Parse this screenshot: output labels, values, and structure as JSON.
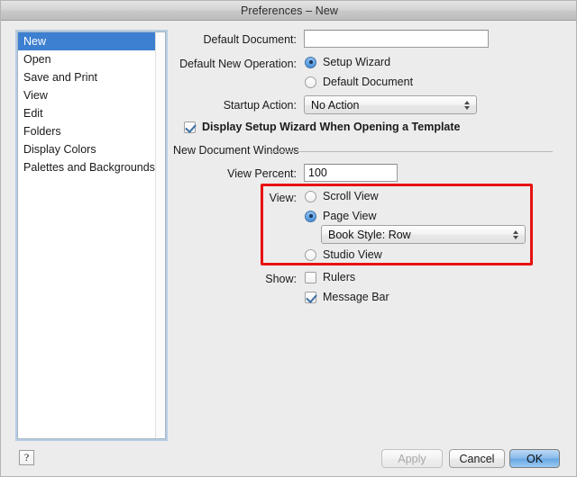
{
  "window": {
    "title": "Preferences – New"
  },
  "sidebar": {
    "items": [
      {
        "label": "New",
        "selected": true
      },
      {
        "label": "Open",
        "selected": false
      },
      {
        "label": "Save and Print",
        "selected": false
      },
      {
        "label": "View",
        "selected": false
      },
      {
        "label": "Edit",
        "selected": false
      },
      {
        "label": "Folders",
        "selected": false
      },
      {
        "label": "Display Colors",
        "selected": false
      },
      {
        "label": "Palettes and Backgrounds",
        "selected": false
      }
    ]
  },
  "form": {
    "default_document_label": "Default Document:",
    "default_document_value": "",
    "default_new_operation_label": "Default New Operation:",
    "setup_wizard_label": "Setup Wizard",
    "default_document_radio_label": "Default Document",
    "startup_action_label": "Startup Action:",
    "startup_action_value": "No Action",
    "display_setup_wizard_label": "Display Setup Wizard When Opening a Template"
  },
  "group": {
    "title": "New Document Windows",
    "view_percent_label": "View Percent:",
    "view_percent_value": "100",
    "view_label": "View:",
    "scroll_view_label": "Scroll View",
    "page_view_label": "Page View",
    "book_style_value": "Book Style: Row",
    "studio_view_label": "Studio View",
    "show_label": "Show:",
    "rulers_label": "Rulers",
    "message_bar_label": "Message Bar"
  },
  "footer": {
    "help_glyph": "?",
    "apply_label": "Apply",
    "cancel_label": "Cancel",
    "ok_label": "OK"
  },
  "colors": {
    "selection_blue": "#3d7fd0",
    "annotation_red": "#e81111",
    "default_button_blue": "#8cbdec",
    "dialog_background": "#ececec"
  }
}
